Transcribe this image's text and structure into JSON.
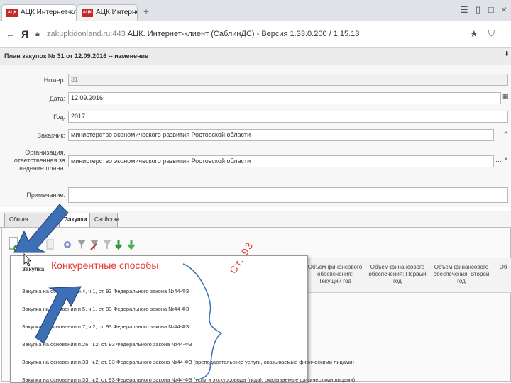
{
  "browser": {
    "tabs": [
      {
        "label": "АЦК Интернет-клиен",
        "favicon": "АЦК"
      },
      {
        "label": "АЦК Интернет-клиен",
        "favicon": "АЦК"
      }
    ],
    "url_host": "zakupkidonland.ru:443",
    "page_title": "АЦК. Интернет-клиент (СаблинДС) - Версия 1.33.0.200 / 1.15.13",
    "icons": [
      "back-icon",
      "yandex-icon",
      "lock-icon",
      "star-icon",
      "shield-icon",
      "menu-icon",
      "minimize-icon",
      "maximize-icon",
      "close-icon"
    ]
  },
  "document": {
    "title": "План закупок № 31 от 12.09.2016 -- изменение",
    "fields": [
      {
        "label": "Номер:",
        "value": "31"
      },
      {
        "label": "Дата:",
        "value": "12.09.2016"
      },
      {
        "label": "Год:",
        "value": "2017"
      },
      {
        "label": "Заказчик:",
        "value": "министерство экономического развития Ростовской области"
      },
      {
        "label": "Организация, ответственная за ведение плана:",
        "value": "министерство экономического развития Ростовской области"
      },
      {
        "label": "Примечание:",
        "value": ""
      }
    ]
  },
  "tabs": [
    "Общая информация",
    "Закупки",
    "Свойства"
  ],
  "grid": {
    "headers": [
      "Объем финансового обеспечения: Текущий год",
      "Объем финансового обеспечения: Первый год",
      "Объем финансового обеспечения: Второй год",
      "Об"
    ]
  },
  "dropdown": {
    "header": "Закупка",
    "items": [
      "Закупка на основании п.4, ч.1, ст. 93 Федерального закона №44-ФЗ",
      "Закупка на основании п.5, ч.1, ст. 93 Федерального закона №44-ФЗ",
      "Закупка на основании п.7, ч.2, ст. 93 Федерального закона №44-ФЗ",
      "Закупка на основании п.26, ч.2, ст. 93 Федерального закона №44-ФЗ",
      "Закупка на основании п.33, ч.2, ст. 93 Федерального закона №44-ФЗ (преподавательские услуги, оказываемые физическими лицами)",
      "Закупка на основании п.33, ч.2, ст. 93 Федерального закона №44-ФЗ (услуги экскурсовода (гида), оказываемые физическими лицами)"
    ]
  },
  "annotations": {
    "competitive": "Конкурентные способы",
    "article": "Ст. 93"
  },
  "colors": {
    "arrow": "#3d6fb6",
    "annotation": "#e53935",
    "favicon": "#c62828"
  }
}
